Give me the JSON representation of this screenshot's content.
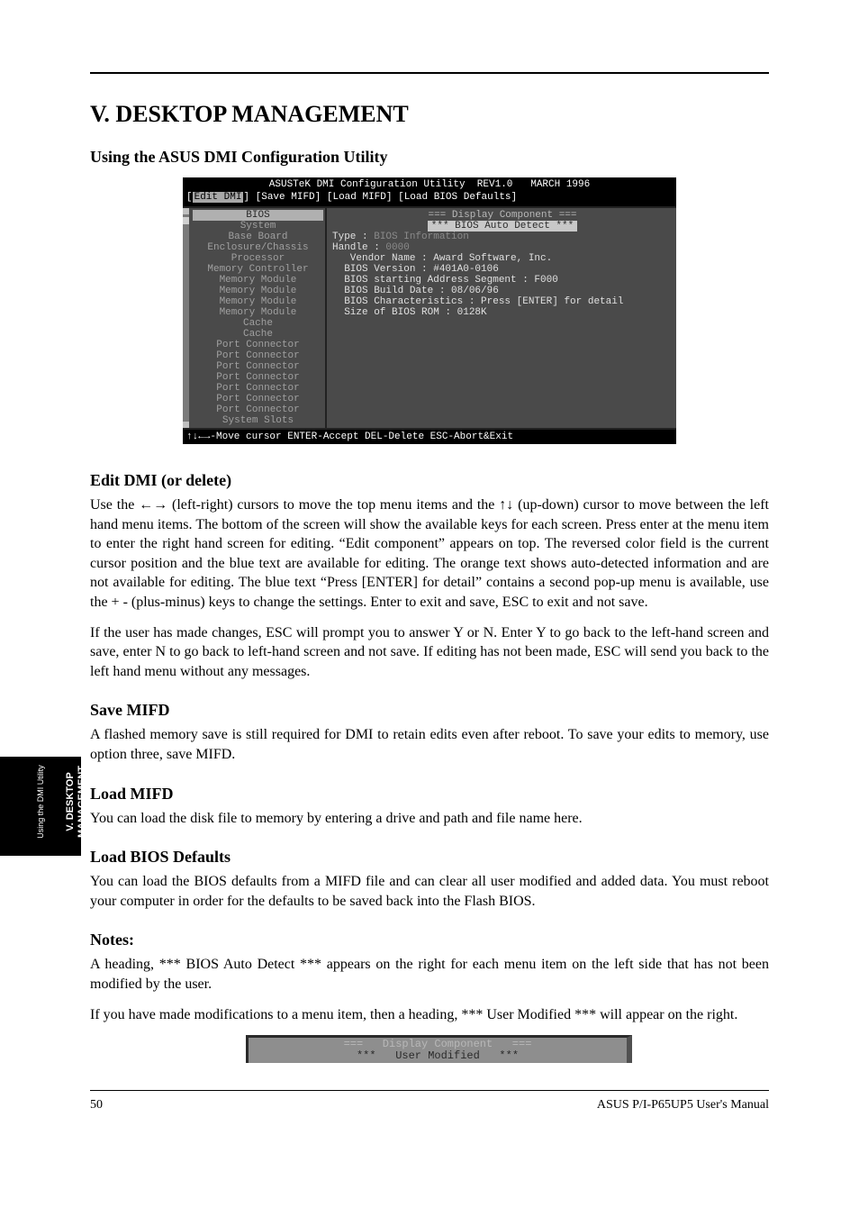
{
  "header": {
    "section_tab_roman": "V. DESKTOP MANAGEMENT",
    "section_tab_sub": "Using the DMI Utility",
    "section_title": "V. DESKTOP MANAGEMENT"
  },
  "subsections": {
    "using_title": "Using the ASUS DMI Configuration Utility",
    "edit_title": "Edit DMI (or delete)",
    "save_title": "Save MIFD",
    "load_title": "Load MIFD",
    "load_bios_title": "Load BIOS Defaults",
    "notes_title": "Notes:"
  },
  "paragraphs": {
    "edit_p1": "Use the ←→ (left-right) cursors to move the top menu items and the ↑↓ (up-down) cursor to move between the left hand menu items. The bottom of the screen will show the available keys for each screen. Press enter at the menu item to enter the right hand screen for editing. “Edit component” appears on top. The reversed color field is the current cursor position and the blue text are available for editing. The orange text shows auto-detected information and are not available for editing. The blue text “Press [ENTER] for detail” contains a second pop-up menu is available, use the + - (plus-minus) keys to change the settings. Enter to exit and save, ESC to exit and not save.",
    "edit_p2": "If the user has made changes, ESC will prompt you to answer Y or N. Enter Y to go back to the left-hand screen and save, enter N to go back to left-hand screen and not save. If editing has not been made, ESC will send you back to the left hand menu without any messages.",
    "save_p1": "A flashed memory save is still required for DMI to retain edits even after reboot. To save your edits to memory, use option three, save MIFD.",
    "load_p1": "You can load the disk file to memory by entering a drive and path and file name here.",
    "load_bios_p1": "You can load the BIOS defaults from a MIFD file and can clear all user modified and added data. You must reboot your computer in order for the defaults to be saved back into the Flash BIOS.",
    "notes_p1": "A heading, *** BIOS Auto Detect *** appears on the right for each menu item on the left side that has not been modified by the user.",
    "notes_p2": "If you have made modifications to a menu item, then a heading, *** User Modified *** will appear on the right."
  },
  "bios": {
    "title": "ASUSTeK DMI Configuration Utility  REV1.0   MARCH 1996",
    "menu_items": [
      "Edit DMI",
      "Save MIFD",
      "Load MIFD",
      "Load BIOS Defaults"
    ],
    "left_items": [
      "BIOS",
      "System",
      "Base Board",
      "Enclosure/Chassis",
      "Processor",
      "Memory Controller",
      "Memory Module",
      "Memory Module",
      "Memory Module",
      "Memory Module",
      "Cache",
      "Cache",
      "Port Connector",
      "Port Connector",
      "Port Connector",
      "Port Connector",
      "Port Connector",
      "Port Connector",
      "Port Connector",
      "System Slots"
    ],
    "selected_left_index": 0,
    "right_header": "===   Display Component   ===",
    "right_auto_detect": "***   BIOS Auto Detect   ***",
    "type_label": "Type",
    "type_value": "BIOS Information",
    "handle_label": "Handle",
    "handle_value": "0000",
    "lines": [
      "   Vendor Name : Award Software, Inc.",
      "  BIOS Version : #401A0-0106",
      "  BIOS starting Address Segment : F000",
      "  BIOS Build Date : 08/06/96",
      "  BIOS Characteristics : Press [ENTER] for detail",
      "  Size of BIOS ROM : 0128K"
    ],
    "footer": "↑↓←→-Move cursor ENTER-Accept DEL-Delete ESC-Abort&Exit"
  },
  "snippet": {
    "line1": "===   Display Component   ===",
    "line2": "***   User Modified   ***"
  },
  "footer": {
    "page": "50",
    "manual": "ASUS P/I-P65UP5 User's Manual"
  }
}
